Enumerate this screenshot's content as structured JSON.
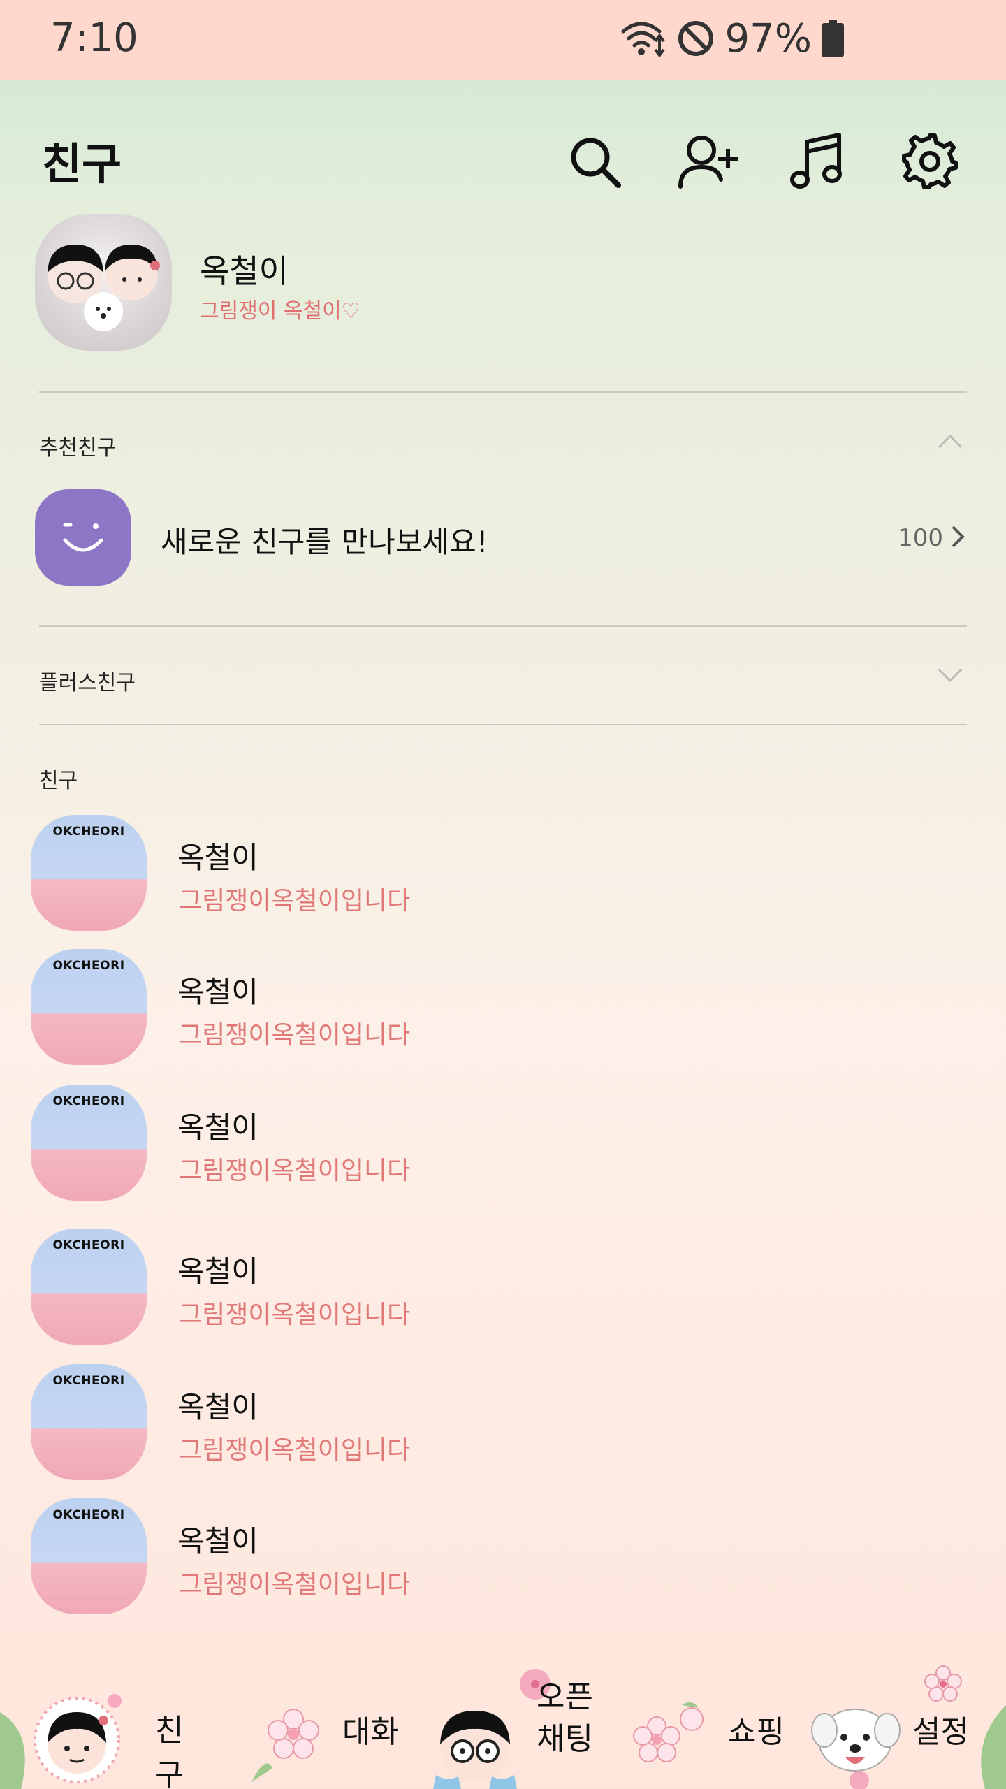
{
  "status_bar": {
    "time": "7:10",
    "battery": "97%",
    "icons": [
      "wifi-icon",
      "do-not-disturb-icon",
      "battery-icon"
    ]
  },
  "header": {
    "title": "친구",
    "icons": [
      "search-icon",
      "add-friend-icon",
      "music-icon",
      "settings-icon"
    ]
  },
  "my_profile": {
    "name": "옥철이",
    "status": "그림쟁이 옥철이♡"
  },
  "sections": {
    "recommended": "추천친구",
    "plus_friends": "플러스친구",
    "friends": "친구"
  },
  "recommend": {
    "text": "새로운 친구를 만나보세요!",
    "count": "100"
  },
  "friend_avatar_label": "OKCHEORI",
  "friends": [
    {
      "name": "옥철이",
      "status": "그림쟁이옥철이입니다"
    },
    {
      "name": "옥철이",
      "status": "그림쟁이옥철이입니다"
    },
    {
      "name": "옥철이",
      "status": "그림쟁이옥철이입니다"
    },
    {
      "name": "옥철이",
      "status": "그림쟁이옥철이입니다"
    },
    {
      "name": "옥철이",
      "status": "그림쟁이옥철이입니다"
    },
    {
      "name": "옥철이",
      "status": "그림쟁이옥철이입니다"
    }
  ],
  "bottom_nav": {
    "friends": "친구",
    "chats": "대화",
    "open_chat_1": "오픈",
    "open_chat_2": "채팅",
    "shopping": "쇼핑",
    "settings": "설정"
  },
  "colors": {
    "status_bar_bg": "#ffd8cd",
    "status_text_pink": "#e07877",
    "recommend_avatar": "#8e76c6"
  }
}
